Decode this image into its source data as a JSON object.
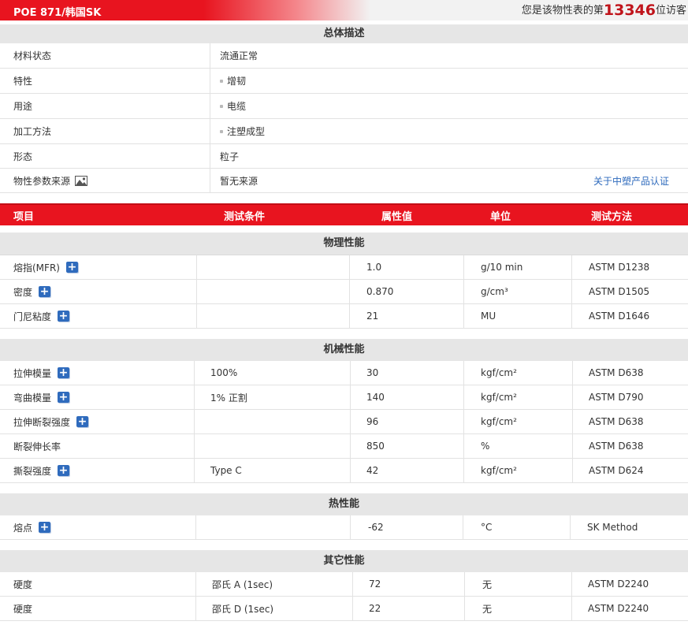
{
  "header": {
    "title": "POE 871/韩国SK",
    "visitor_prefix": "您是该物性表的第",
    "visitor_count": "13346",
    "visitor_suffix": "位访客"
  },
  "overview": {
    "heading": "总体描述",
    "rows": [
      {
        "label": "材料状态",
        "value": "流通正常"
      },
      {
        "label": "特性",
        "value": "增韧"
      },
      {
        "label": "用途",
        "value": "电缆"
      },
      {
        "label": "加工方法",
        "value": "注塑成型"
      },
      {
        "label": "形态",
        "value": "粒子"
      },
      {
        "label": "物性参数来源",
        "value": "暂无来源",
        "link": "关于中塑产品认证"
      }
    ]
  },
  "table_header": [
    "项目",
    "测试条件",
    "属性值",
    "单位",
    "测试方法"
  ],
  "sections": {
    "physical": {
      "heading": "物理性能",
      "rows": [
        {
          "name": "熔指(MFR)",
          "cond": "",
          "value": "1.0",
          "unit": "g/10 min",
          "method": "ASTM D1238"
        },
        {
          "name": "密度",
          "cond": "",
          "value": "0.870",
          "unit": "g/cm³",
          "method": "ASTM D1505"
        },
        {
          "name": "门尼粘度",
          "cond": "",
          "value": "21",
          "unit": "MU",
          "method": "ASTM D1646"
        }
      ]
    },
    "mechanical": {
      "heading": "机械性能",
      "rows": [
        {
          "name": "拉伸模量",
          "cond": "100%",
          "value": "30",
          "unit": "kgf/cm²",
          "method": "ASTM D638"
        },
        {
          "name": "弯曲模量",
          "cond": "1% 正割",
          "value": "140",
          "unit": "kgf/cm²",
          "method": "ASTM D790"
        },
        {
          "name": "拉伸断裂强度",
          "cond": "",
          "value": "96",
          "unit": "kgf/cm²",
          "method": "ASTM D638"
        },
        {
          "name": "断裂伸长率",
          "cond": "",
          "value": "850",
          "unit": "%",
          "method": "ASTM D638"
        },
        {
          "name": "撕裂强度",
          "cond": "Type C",
          "value": "42",
          "unit": "kgf/cm²",
          "method": "ASTM D624"
        }
      ]
    },
    "thermal": {
      "heading": "热性能",
      "rows": [
        {
          "name": "熔点",
          "cond": "",
          "value": "-62",
          "unit": "°C",
          "method": "SK Method"
        }
      ]
    },
    "other": {
      "heading": "其它性能",
      "rows": [
        {
          "name": "硬度",
          "cond": "邵氏 A (1sec)",
          "value": "72",
          "unit": "无",
          "method": "ASTM D2240"
        },
        {
          "name": "硬度",
          "cond": "邵氏 D (1sec)",
          "value": "22",
          "unit": "无",
          "method": "ASTM D2240"
        }
      ]
    }
  },
  "icons": {
    "expand": "plus-icon",
    "source": "image-icon"
  }
}
